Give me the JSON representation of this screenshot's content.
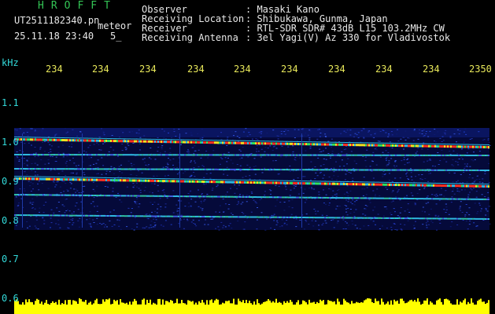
{
  "app": {
    "logo": "HROFFT"
  },
  "file": {
    "name": "UT2511182340.pn",
    "mode": "meteor",
    "datetime": "25.11.18 23:40",
    "extra": "5_"
  },
  "info": {
    "labels": [
      "Observer",
      "Receiving Location",
      "Receiver",
      "Receiving Antenna"
    ],
    "values": [
      ": Masaki Kano",
      ": Shibukawa, Gunma, Japan",
      ": RTL-SDR SDR# 43dB L15 103.2MHz CW",
      ": 3el Yagi(V) Az 330 for Vladivostok"
    ]
  },
  "axis": {
    "unit": "kHz",
    "time_ticks": [
      "234",
      "234",
      "234",
      "234",
      "234",
      "234",
      "234",
      "234",
      "234",
      "2350"
    ],
    "freq_ticks": [
      "1.1",
      "1.0",
      "0.9",
      "0.8",
      "0.7",
      "0.6"
    ]
  },
  "colors": {
    "background": "#000000",
    "signal_low": "#1a2a9a",
    "signal_high": "#ff3020",
    "amplitude": "#ffff00",
    "label": "#33dada"
  }
}
